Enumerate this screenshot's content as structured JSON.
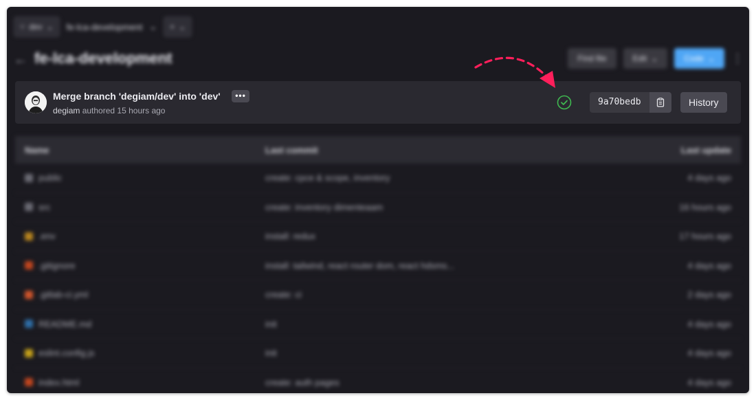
{
  "toolbar": {
    "branch_label": "dev",
    "breadcrumb": "fe-lca-development",
    "extra_label": ""
  },
  "header": {
    "title": "fe-lca-development",
    "find_file": "Find file",
    "edit": "Edit",
    "code": "Code"
  },
  "commit": {
    "message": "Merge branch 'degiam/dev' into 'dev'",
    "more": "•••",
    "author": "degiam",
    "meta": "authored 15 hours ago",
    "sha": "9a70bedb",
    "history_label": "History",
    "status_color": "#3fb950"
  },
  "files": {
    "headers": [
      "Name",
      "Last commit",
      "Last update"
    ],
    "rows": [
      {
        "name": "public",
        "commit": "create: cpce & scope, inventory",
        "updated": "4 days ago",
        "icon_color": "#6b6b74"
      },
      {
        "name": "src",
        "commit": "create: inventory dimenteaam",
        "updated": "16 hours ago",
        "icon_color": "#6b6b74"
      },
      {
        "name": ".env",
        "commit": "install: redux",
        "updated": "17 hours ago",
        "icon_color": "#b9861f"
      },
      {
        "name": ".gitignore",
        "commit": "install: tailwind, react router dom, react hdsms...",
        "updated": "4 days ago",
        "icon_color": "#c2461f"
      },
      {
        "name": ".gitlab-ci.yml",
        "commit": "create: ci",
        "updated": "2 days ago",
        "icon_color": "#d0552b"
      },
      {
        "name": "README.md",
        "commit": "init",
        "updated": "4 days ago",
        "icon_color": "#2f6fa8"
      },
      {
        "name": "eslint.config.js",
        "commit": "init",
        "updated": "4 days ago",
        "icon_color": "#c6a21a"
      },
      {
        "name": "index.html",
        "commit": "create: auth pages",
        "updated": "4 days ago",
        "icon_color": "#c2461f"
      }
    ]
  },
  "annotation": {
    "arrow_color": "#ff1f5b"
  }
}
